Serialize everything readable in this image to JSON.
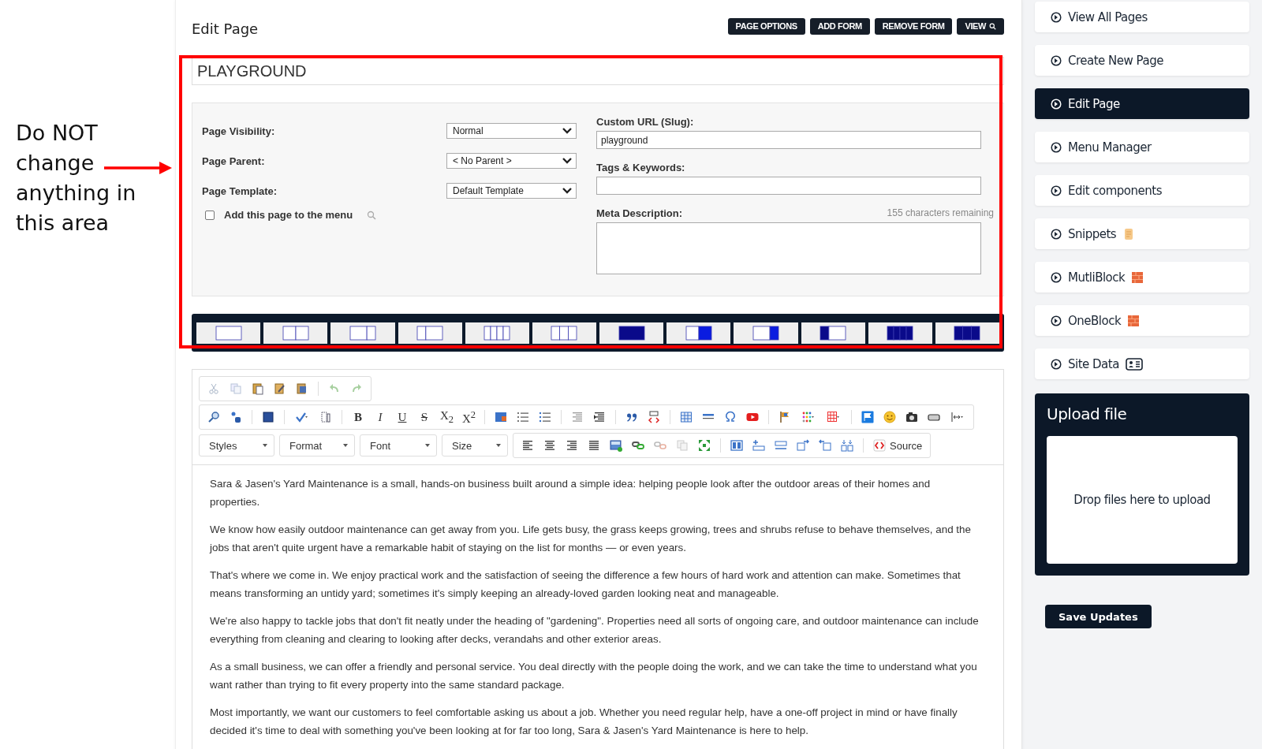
{
  "annotation": {
    "lines": [
      "Do NOT",
      "change",
      "anything in",
      "this area"
    ]
  },
  "header": {
    "title": "Edit Page",
    "buttons": [
      {
        "label": "PAGE OPTIONS"
      },
      {
        "label": "ADD FORM"
      },
      {
        "label": "REMOVE FORM"
      },
      {
        "label": "VIEW"
      }
    ]
  },
  "title_field": {
    "value": "PLAYGROUND"
  },
  "settings": {
    "fields": [
      {
        "label": "Page Visibility:",
        "value": "Normal"
      },
      {
        "label": "Page Parent:",
        "value": "< No Parent >"
      },
      {
        "label": "Page Template:",
        "value": "Default Template"
      }
    ],
    "menu_checkbox": {
      "label": "Add this page to the menu",
      "checked": false
    },
    "slug": {
      "label": "Custom URL (Slug):",
      "value": "playground"
    },
    "tags": {
      "label": "Tags & Keywords:"
    },
    "meta": {
      "label": "Meta Description:",
      "counter": "155 characters remaining"
    }
  },
  "editor": {
    "text_buttons": [
      "B",
      "I",
      "U",
      "S",
      "X$_{2}$",
      "X$^{2}$"
    ],
    "dropdowns": [
      "Styles",
      "Format",
      "Font",
      "Size"
    ],
    "source_label": "Source",
    "paragraphs": [
      "Sara & Jasen's Yard Maintenance is a small, hands-on business built around a simple idea: helping people look after the outdoor areas of their homes and properties.",
      "We know how easily outdoor maintenance can get away from you. Life gets busy, the grass keeps growing, trees and shrubs refuse to behave themselves, and the jobs that aren't quite urgent have a remarkable habit of staying on the list for months — or even years.",
      "That's where we come in. We enjoy practical work and the satisfaction of seeing the difference a few hours of hard work and attention can make. Sometimes that means transforming an untidy yard; sometimes it's simply keeping an already-loved garden looking neat and manageable.",
      "We're also happy to tackle jobs that don't fit neatly under the heading of \"gardening\". Properties need all sorts of ongoing care, and outdoor maintenance can include everything from cleaning and clearing to looking after decks, verandahs and other exterior areas.",
      "As a small business, we can offer a friendly and personal service. You deal directly with the people doing the work, and we can take the time to understand what you want rather than trying to fit every property into the same standard package.",
      "Most importantly, we want our customers to feel comfortable asking us about a job. Whether you need regular help, have a one-off project in mind or have finally decided it's time to deal with something you've been looking at for far too long, Sara & Jasen's Yard Maintenance is here to help."
    ]
  },
  "sidebar": {
    "items": [
      {
        "label": "View All Pages",
        "selected": false
      },
      {
        "label": "Create New Page",
        "selected": false
      },
      {
        "label": "Edit Page",
        "selected": true
      },
      {
        "label": "Menu Manager",
        "selected": false
      },
      {
        "label": "Edit components",
        "selected": false
      },
      {
        "label": "Snippets",
        "selected": false
      },
      {
        "label": "MutliBlock",
        "selected": false
      },
      {
        "label": "OneBlock",
        "selected": false
      },
      {
        "label": "Site Data",
        "selected": false
      }
    ]
  },
  "upload": {
    "title": "Upload file",
    "hint": "Drop files here to upload"
  },
  "save_button": "Save Updates"
}
